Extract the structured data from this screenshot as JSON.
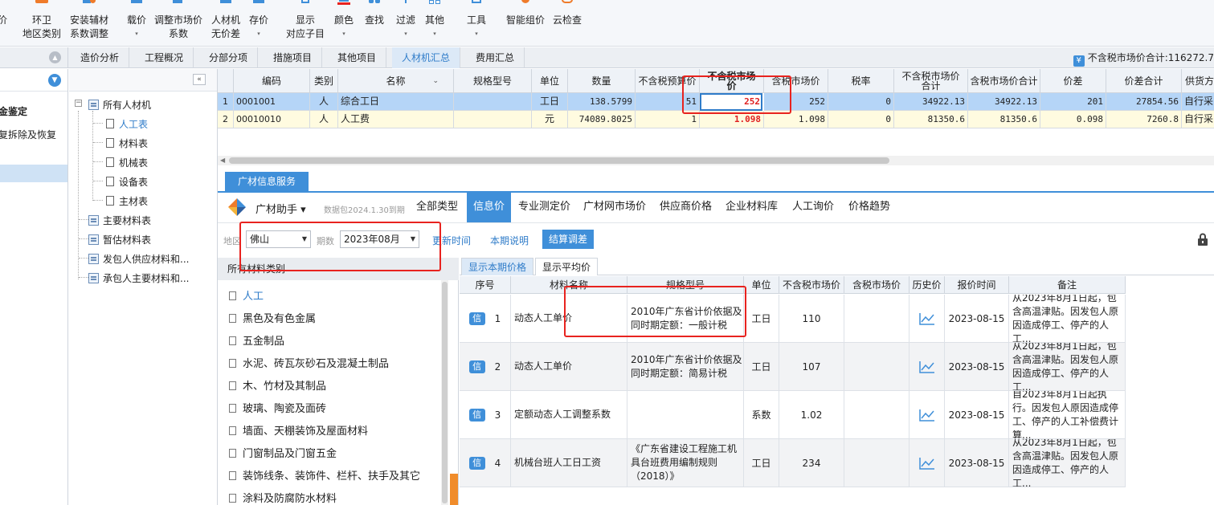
{
  "colors": {
    "accent": "#3f8fd9",
    "highlight_red": "#e02020",
    "annotation_red": "#e8231f",
    "selected_row": "#b5d5f7",
    "second_row": "#fffbe0"
  },
  "ribbon": [
    {
      "line1": "价",
      "line2": ""
    },
    {
      "line1": "环卫",
      "line2": "地区类别"
    },
    {
      "line1": "安装辅材",
      "line2": "系数调整"
    },
    {
      "line1": "载价",
      "line2": "▾"
    },
    {
      "line1": "调整市场价",
      "line2": "系数"
    },
    {
      "line1": "人材机",
      "line2": "无价差"
    },
    {
      "line1": "存价",
      "line2": "▾"
    },
    {
      "line1": "显示",
      "line2": "对应子目"
    },
    {
      "line1": "颜色",
      "line2": "▾"
    },
    {
      "line1": "查找",
      "line2": ""
    },
    {
      "line1": "过滤",
      "line2": "▾"
    },
    {
      "line1": "其他",
      "line2": "▾"
    },
    {
      "line1": "工具",
      "line2": "▾"
    },
    {
      "line1": "智能组价",
      "line2": ""
    },
    {
      "line1": "云检查",
      "line2": ""
    }
  ],
  "main_tabs": [
    "造价分析",
    "工程概况",
    "分部分项",
    "措施项目",
    "其他项目",
    "人材机汇总",
    "费用汇总"
  ],
  "active_main_tab": "人材机汇总",
  "tax_total_text": "不含税市场价合计:116272.7",
  "far_left": {
    "item1": "金鉴定",
    "item2": "复拆除及恢复"
  },
  "tree": {
    "root": "所有人材机",
    "children": [
      "人工表",
      "材料表",
      "机械表",
      "设备表",
      "主材表"
    ],
    "others": [
      "主要材料表",
      "暂估材料表",
      "发包人供应材料和...",
      "承包人主要材料和..."
    ]
  },
  "grid": {
    "headers": [
      "",
      "编码",
      "类别",
      "名称",
      "规格型号",
      "单位",
      "数量",
      "不含税预算价",
      "不含税市场价",
      "含税市场价",
      "税率",
      "不含税市场价合计",
      "含税市场价合计",
      "价差",
      "价差合计",
      "供货方"
    ],
    "name_sort_icon": "chevron-down-icon",
    "rows": [
      {
        "no": "1",
        "code": "0001001",
        "type": "人",
        "name": "综合工日",
        "spec": "",
        "unit": "工日",
        "qty": "138.5799",
        "budget": "51",
        "market": "252",
        "market_tax": "252",
        "rate": "0",
        "market_total": "34922.13",
        "market_tax_total": "34922.13",
        "diff": "201",
        "diff_total": "27854.56",
        "supplier": "自行采"
      },
      {
        "no": "2",
        "code": "00010010",
        "type": "人",
        "name": "人工费",
        "spec": "",
        "unit": "元",
        "qty": "74089.8025",
        "budget": "1",
        "market": "1.098",
        "market_tax": "1.098",
        "rate": "0",
        "market_total": "81350.6",
        "market_tax_total": "81350.6",
        "diff": "0.098",
        "diff_total": "7260.8",
        "supplier": "自行采"
      }
    ]
  },
  "info": {
    "tab": "广材信息服务",
    "assistant": "广材助手 ▾",
    "datapkg": "数据包2024.1.30到期",
    "subtabs": [
      "全部类型",
      "信息价",
      "专业测定价",
      "广材网市场价",
      "供应商价格",
      "企业材料库",
      "人工询价",
      "价格趋势"
    ],
    "active_subtab": "信息价",
    "region_label": "地区",
    "region": "佛山",
    "period_label": "期数",
    "period": "2023年08月",
    "update_time": "更新时间",
    "period_note": "本期说明",
    "calc_btn": "结算调差"
  },
  "categories": {
    "header": "所有材料类别",
    "items": [
      "人工",
      "黑色及有色金属",
      "五金制品",
      "水泥、砖瓦灰砂石及混凝土制品",
      "木、竹材及其制品",
      "玻璃、陶瓷及面砖",
      "墙面、天棚装饰及屋面材料",
      "门窗制品及门窗五金",
      "装饰线条、装饰件、栏杆、扶手及其它",
      "涂料及防腐防水材料"
    ]
  },
  "price": {
    "tabs": [
      "显示本期价格",
      "显示平均价"
    ],
    "headers": [
      "序号",
      "材料名称",
      "规格型号",
      "单位",
      "不含税市场价",
      "含税市场价",
      "历史价",
      "报价时间",
      "备注"
    ],
    "badge": "信",
    "rows": [
      {
        "no": "1",
        "name": "动态人工单价",
        "spec": "2010年广东省计价依据及同时期定额：一般计税",
        "unit": "工日",
        "price": "110",
        "price_tax": "",
        "date": "2023-08-15",
        "note": "从2023年8月1日起，包含高温津贴。因发包人原因造成停工、停产的人工..."
      },
      {
        "no": "2",
        "name": "动态人工单价",
        "spec": "2010年广东省计价依据及同时期定额：简易计税",
        "unit": "工日",
        "price": "107",
        "price_tax": "",
        "date": "2023-08-15",
        "note": "从2023年8月1日起，包含高温津贴。因发包人原因造成停工、停产的人工..."
      },
      {
        "no": "3",
        "name": "定额动态人工调整系数",
        "spec": "",
        "unit": "系数",
        "price": "1.02",
        "price_tax": "",
        "date": "2023-08-15",
        "note": "自2023年8月1日起执行。因发包人原因造成停工、停产的人工补偿费计算..."
      },
      {
        "no": "4",
        "name": "机械台班人工日工资",
        "spec": "《广东省建设工程施工机具台班费用编制规则（2018）》",
        "unit": "工日",
        "price": "234",
        "price_tax": "",
        "date": "2023-08-15",
        "note": "从2023年8月1日起，包含高温津贴。因发包人原因造成停工、停产的人工..."
      }
    ]
  }
}
